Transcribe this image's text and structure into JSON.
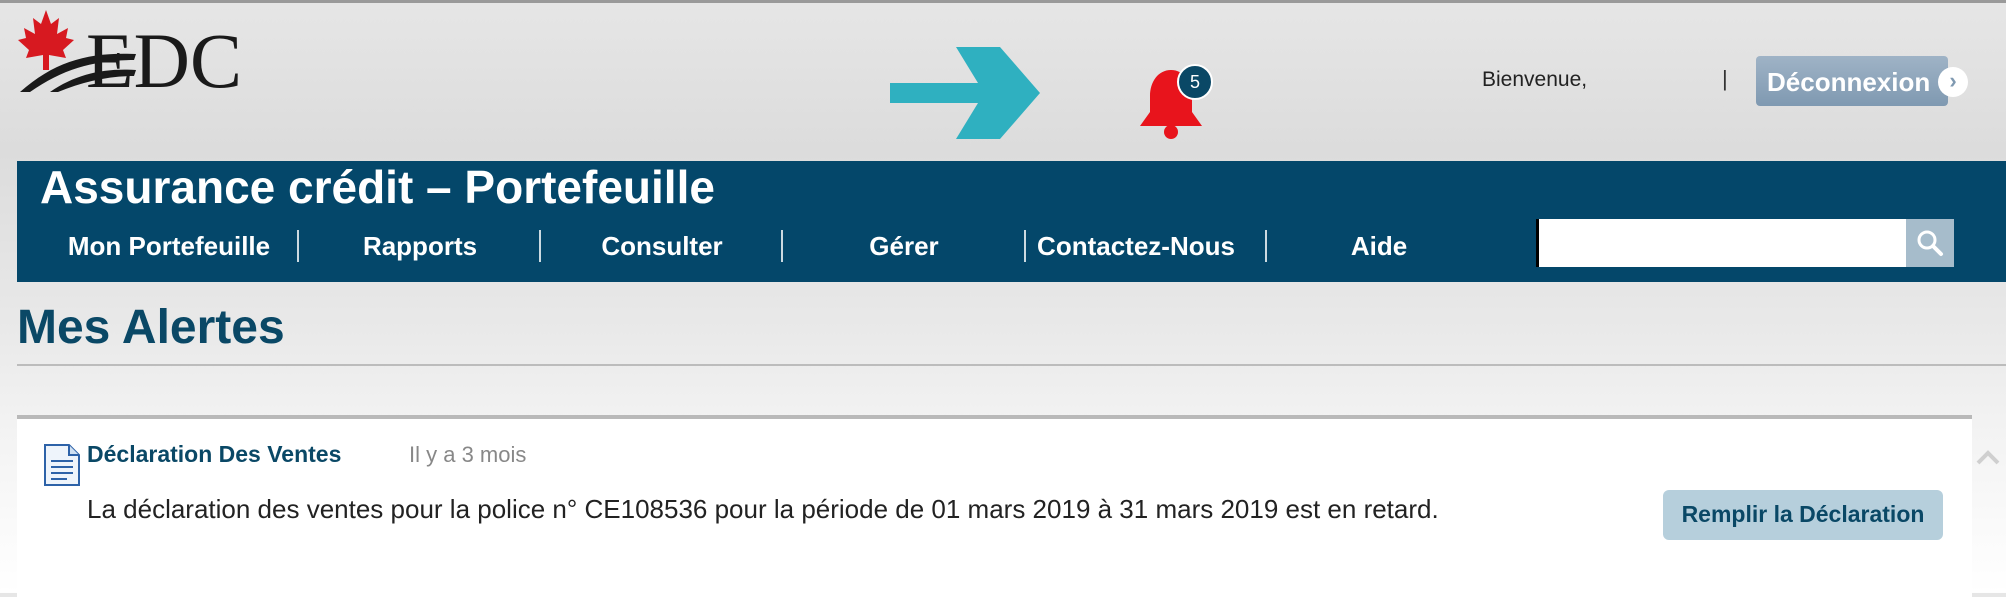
{
  "header": {
    "logo_text": "EDC",
    "notification_count": "5",
    "welcome": "Bienvenue,",
    "separator": "|",
    "logout_label": "Déconnexion",
    "logout_icon": "chevron-right-circle-icon"
  },
  "banner": {
    "title": "Assurance crédit – Portefeuille",
    "nav": [
      {
        "label": "Mon Portefeuille"
      },
      {
        "label": "Rapports"
      },
      {
        "label": "Consulter"
      },
      {
        "label": "Gérer"
      },
      {
        "label": "Contactez-Nous"
      },
      {
        "label": "Aide"
      }
    ],
    "search": {
      "value": "",
      "placeholder": "",
      "icon": "search-icon"
    }
  },
  "page": {
    "title": "Mes Alertes"
  },
  "alerts": [
    {
      "icon": "document-icon",
      "title": "Déclaration Des Ventes",
      "time": "Il y a 3 mois",
      "message": "La déclaration des ventes pour la police n° CE108536 pour la période de 01 mars 2019 à 31 mars 2019 est en retard.",
      "action_label": "Remplir la Déclaration"
    }
  ],
  "colors": {
    "brand_blue": "#04476a",
    "title_blue": "#0a4866",
    "arrow_teal": "#2fb0c0",
    "bell_red": "#e8141c",
    "maple_red": "#d71920",
    "button_light": "#b6cfdc"
  }
}
